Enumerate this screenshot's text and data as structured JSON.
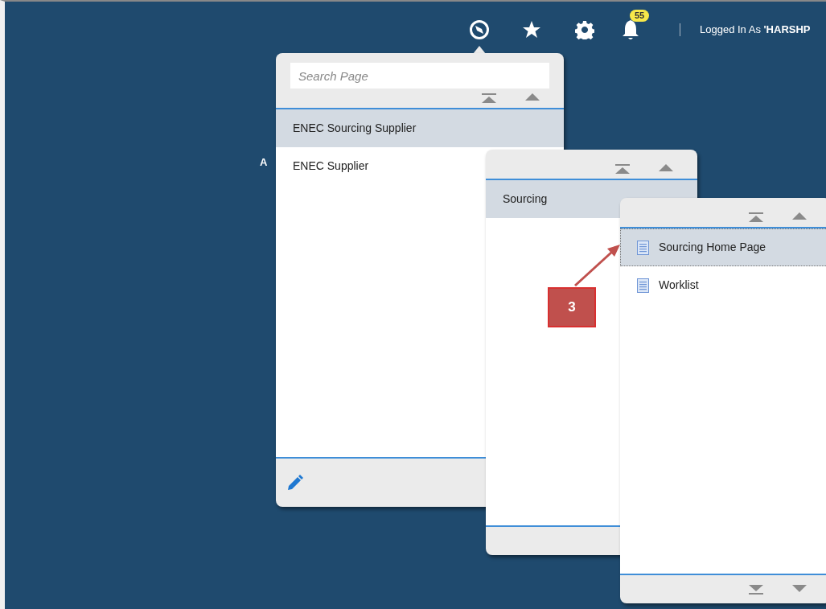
{
  "header": {
    "notification_count": "55",
    "user": "Logged In As **'HARSHP**"
  },
  "background_text": "A",
  "menus": [
    {
      "kind": "search",
      "search": {
        "placeholder": "Search Page"
      },
      "items": [
        {
          "kind": "folder",
          "label": "ENEC Sourcing Supplier",
          "selected": true
        },
        {
          "kind": "folder",
          "label": "ENEC Supplier",
          "selected": false
        }
      ]
    },
    {
      "kind": "plain",
      "items": [
        {
          "kind": "folder",
          "label": "Sourcing",
          "selected": true
        }
      ]
    },
    {
      "kind": "plain",
      "items": [
        {
          "kind": "page",
          "label": "Sourcing Home Page",
          "selected": true
        },
        {
          "kind": "page",
          "label": "Worklist",
          "selected": false
        }
      ]
    }
  ],
  "callout": {
    "label": "3"
  }
}
